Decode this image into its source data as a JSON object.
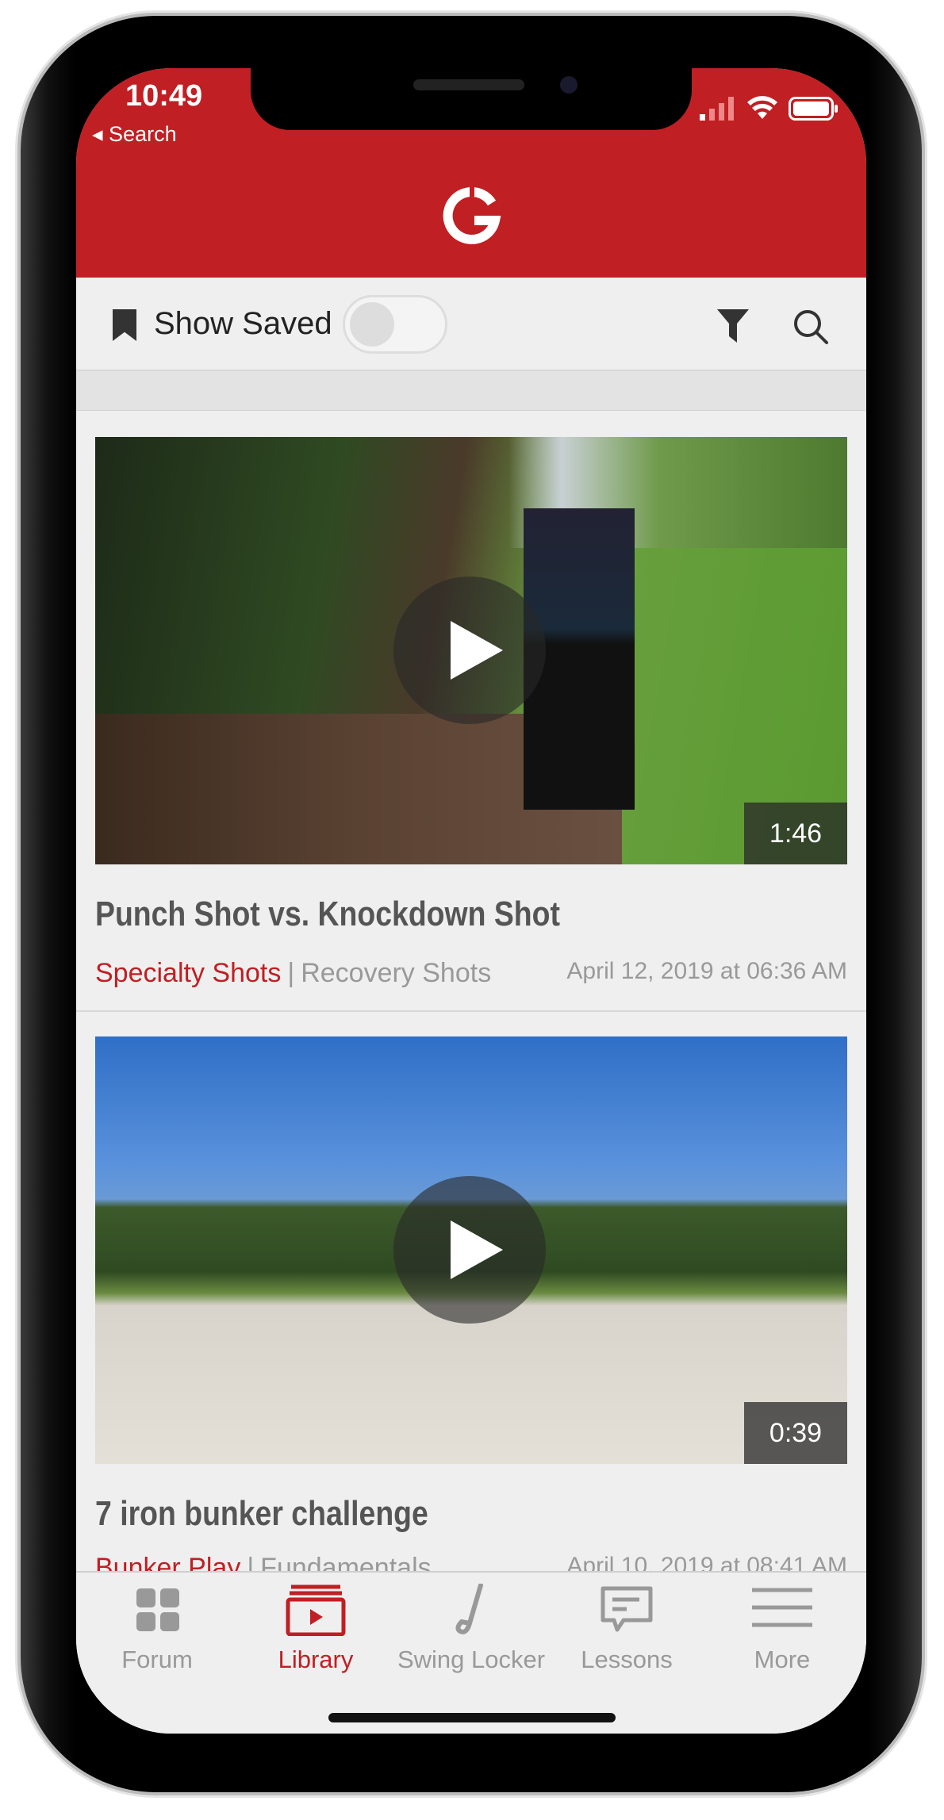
{
  "status_bar": {
    "time": "10:49",
    "back_label": "◂ Search"
  },
  "toolbar": {
    "show_saved_label": "Show Saved",
    "show_saved_on": false
  },
  "videos": [
    {
      "title": "Punch Shot vs. Knockdown Shot",
      "category": "Specialty Shots",
      "subcategory": "Recovery Shots",
      "date": "April 12, 2019 at 06:36 AM",
      "duration": "1:46"
    },
    {
      "title": "7 iron bunker challenge",
      "category": "Bunker Play",
      "subcategory": "Fundamentals",
      "date": "April 10, 2019 at 08:41 AM",
      "duration": "0:39"
    }
  ],
  "separator": "|",
  "tabs": [
    {
      "label": "Forum",
      "icon": "grid-icon"
    },
    {
      "label": "Library",
      "icon": "library-icon",
      "active": true
    },
    {
      "label": "Swing Locker",
      "icon": "golf-club-icon"
    },
    {
      "label": "Lessons",
      "icon": "chat-icon"
    },
    {
      "label": "More",
      "icon": "menu-icon"
    }
  ],
  "colors": {
    "brand": "#c01f23",
    "background": "#efefef"
  }
}
